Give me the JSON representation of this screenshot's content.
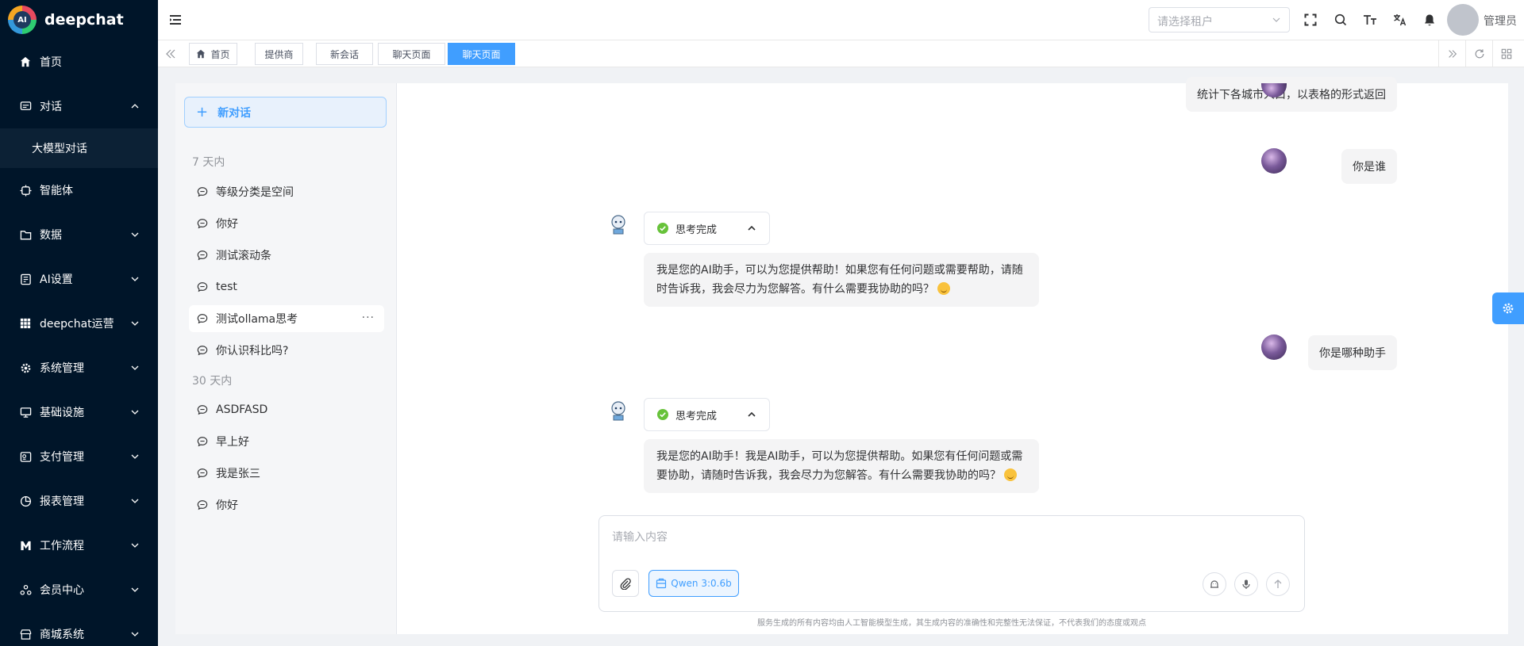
{
  "app": {
    "logo_mark": "AI",
    "name": "deepchat"
  },
  "sidebar": {
    "items": [
      {
        "label": "首页",
        "icon": "home-icon"
      },
      {
        "label": "对话",
        "icon": "chat-icon",
        "expanded": true
      },
      {
        "label": "智能体",
        "icon": "agent-icon"
      },
      {
        "label": "数据",
        "icon": "folder-icon"
      },
      {
        "label": "AI设置",
        "icon": "settings-doc-icon"
      },
      {
        "label": "deepchat运营",
        "icon": "grid-icon"
      },
      {
        "label": "系统管理",
        "icon": "gear-icon"
      },
      {
        "label": "基础设施",
        "icon": "monitor-icon"
      },
      {
        "label": "支付管理",
        "icon": "payment-icon"
      },
      {
        "label": "报表管理",
        "icon": "pie-icon"
      },
      {
        "label": "工作流程",
        "icon": "workflow-icon"
      },
      {
        "label": "会员中心",
        "icon": "member-icon"
      },
      {
        "label": "商城系统",
        "icon": "shop-icon"
      }
    ],
    "submenu": {
      "label": "大模型对话"
    }
  },
  "topbar": {
    "tenant_placeholder": "请选择租户",
    "user_name": "管理员"
  },
  "tabs": [
    {
      "label": "首页"
    },
    {
      "label": "提供商"
    },
    {
      "label": "新会话"
    },
    {
      "label": "聊天页面"
    },
    {
      "label": "聊天页面",
      "active": true
    }
  ],
  "conversations": {
    "new_chat_label": "新对话",
    "groups": [
      {
        "label": "7 天内",
        "items": [
          "等级分类是空间",
          "你好",
          "测试滚动条",
          "test",
          "测试ollama思考",
          "你认识科比吗?"
        ]
      },
      {
        "label": "30 天内",
        "items": [
          "ASDFASD",
          "早上好",
          "我是张三",
          "你好"
        ]
      }
    ],
    "more_label": "···"
  },
  "chat": {
    "messages": [
      {
        "role": "user",
        "text": "统计下各城市人口，以表格的形式返回"
      },
      {
        "role": "user",
        "text": "你是谁"
      },
      {
        "role": "assistant",
        "thinking": "思考完成",
        "text": "我是您的AI助手，可以为您提供帮助！如果您有任何问题或需要帮助，请随时告诉我，我会尽力为您解答。有什么需要我协助的吗？"
      },
      {
        "role": "user",
        "text": "你是哪种助手"
      },
      {
        "role": "assistant",
        "thinking": "思考完成",
        "text": "我是您的AI助手！我是AI助手，可以为您提供帮助。如果您有任何问题或需要协助，请随时告诉我，我会尽力为您解答。有什么需要我协助的吗？"
      }
    ]
  },
  "composer": {
    "placeholder": "请输入内容",
    "model_label": "Qwen 3:0.6b",
    "disclaimer": "服务生成的所有内容均由人工智能模型生成，其生成内容的准确性和完整性无法保证，不代表我们的态度或观点"
  },
  "colors": {
    "sidebar_bg": "#001529",
    "accent": "#409eff",
    "success": "#67c23a"
  }
}
